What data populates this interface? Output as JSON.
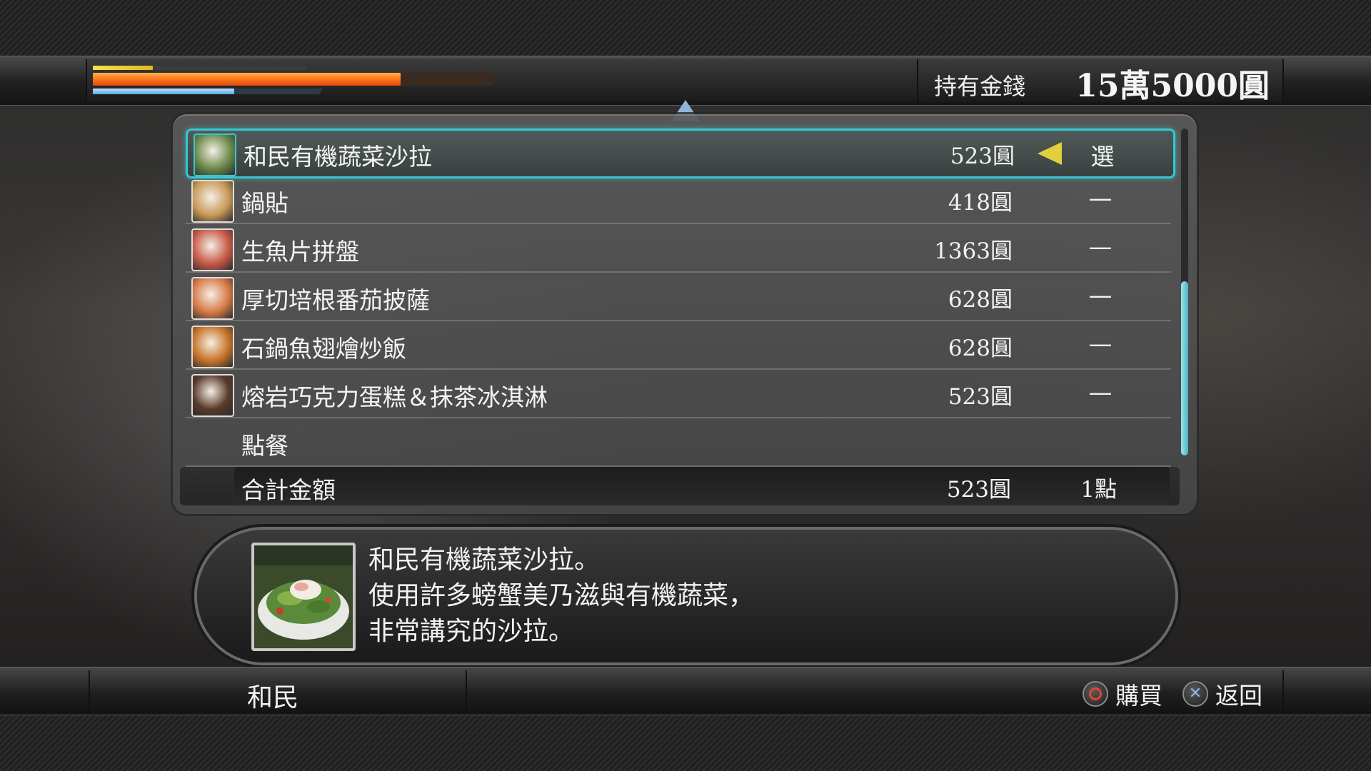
{
  "status": {
    "health_ratio": 0.77,
    "heat_ratio": 0.15,
    "exp_ratio": 0.66
  },
  "money": {
    "label": "持有金錢",
    "value": "15萬5000圓"
  },
  "menu": {
    "items": [
      {
        "name": "和民有機蔬菜沙拉",
        "price": "523圓",
        "qty": "選",
        "selected": true,
        "thumb_color": "#6c8a4a"
      },
      {
        "name": "鍋貼",
        "price": "418圓",
        "qty": "—",
        "selected": false,
        "thumb_color": "#c89a58"
      },
      {
        "name": "生魚片拼盤",
        "price": "1363圓",
        "qty": "—",
        "selected": false,
        "thumb_color": "#c85a48"
      },
      {
        "name": "厚切培根番茄披薩",
        "price": "628圓",
        "qty": "—",
        "selected": false,
        "thumb_color": "#d87a48"
      },
      {
        "name": "石鍋魚翅燴炒飯",
        "price": "628圓",
        "qty": "—",
        "selected": false,
        "thumb_color": "#c87428"
      },
      {
        "name": "熔岩巧克力蛋糕＆抹茶冰淇淋",
        "price": "523圓",
        "qty": "—",
        "selected": false,
        "thumb_color": "#5a3a2a"
      }
    ],
    "order_label": "點餐",
    "total": {
      "label": "合計金額",
      "amount": "523圓",
      "count": "1點"
    }
  },
  "description": {
    "lines": [
      "和民有機蔬菜沙拉。",
      "使用許多螃蟹美乃滋與有機蔬菜，",
      "非常講究的沙拉。"
    ]
  },
  "footer": {
    "shop_name": "和民",
    "buy_label": "購買",
    "back_label": "返回"
  }
}
